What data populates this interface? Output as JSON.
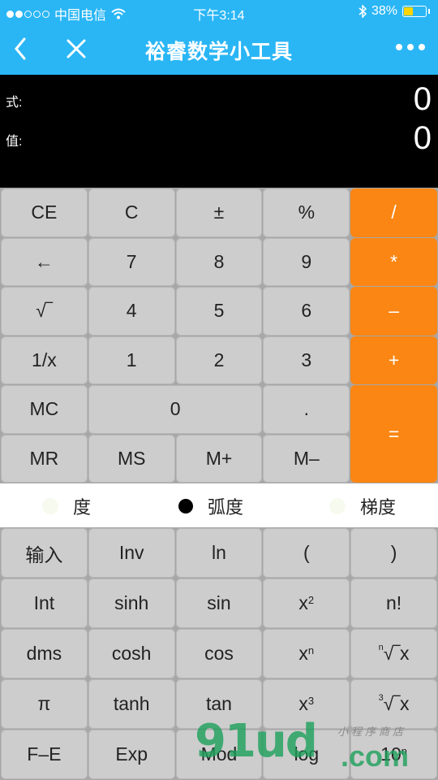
{
  "status_bar": {
    "carrier": "中国电信",
    "time": "下午3:14",
    "battery_percent": "38%",
    "battery_level": 0.38,
    "signal_bars_filled": 2,
    "signal_bars_total": 5,
    "icons": [
      "wifi-icon",
      "bluetooth-icon",
      "battery-icon"
    ]
  },
  "nav": {
    "title": "裕睿数学小工具",
    "icons": [
      "back-chevron-icon",
      "close-icon",
      "more-icon"
    ]
  },
  "display": {
    "expression_label": "式:",
    "expression_value": "0",
    "result_label": "值:",
    "result_value": "0"
  },
  "basic_keys": {
    "ce": "CE",
    "c": "C",
    "sign": "±",
    "percent": "%",
    "divide": "/",
    "backspace": "←",
    "seven": "7",
    "eight": "8",
    "nine": "9",
    "multiply": "*",
    "sqrt": "√‾",
    "four": "4",
    "five": "5",
    "six": "6",
    "subtract": "–",
    "reciprocal": "1/x",
    "one": "1",
    "two": "2",
    "three": "3",
    "add": "+",
    "mc": "MC",
    "zero": "0",
    "dot": ".",
    "equals": "=",
    "mr": "MR",
    "ms": "MS",
    "mplus": "M+",
    "mminus": "M–"
  },
  "angle_modes": {
    "degree": "度",
    "radian": "弧度",
    "gradian": "梯度",
    "selected": "弧度"
  },
  "sci_keys": {
    "input": "输入",
    "inv": "Inv",
    "ln": "ln",
    "lparen": "(",
    "rparen": ")",
    "int": "Int",
    "sinh": "sinh",
    "sin": "sin",
    "sq_base": "x",
    "sq_exp": "2",
    "factorial": "n!",
    "dms": "dms",
    "cosh": "cosh",
    "cos": "cos",
    "pow_base": "x",
    "pow_exp": "n",
    "nroot_idx": "n",
    "nroot_sym": "√‾x",
    "pi": "π",
    "tanh": "tanh",
    "tan": "tan",
    "cube_base": "x",
    "cube_exp": "3",
    "croot_idx": "3",
    "croot_sym": "√‾x",
    "fe": "F–E",
    "exp": "Exp",
    "mod": "Mod",
    "log": "log",
    "ten_base": "10",
    "ten_exp": "n"
  },
  "watermark": {
    "logo_text": "91ud",
    "domain_suffix": ".com",
    "tagline": "小程序商店"
  },
  "colors": {
    "nav_bg": "#2ab6f5",
    "operator_key": "#fb8613",
    "key_bg": "#cdcdcd",
    "display_bg": "#000000"
  }
}
